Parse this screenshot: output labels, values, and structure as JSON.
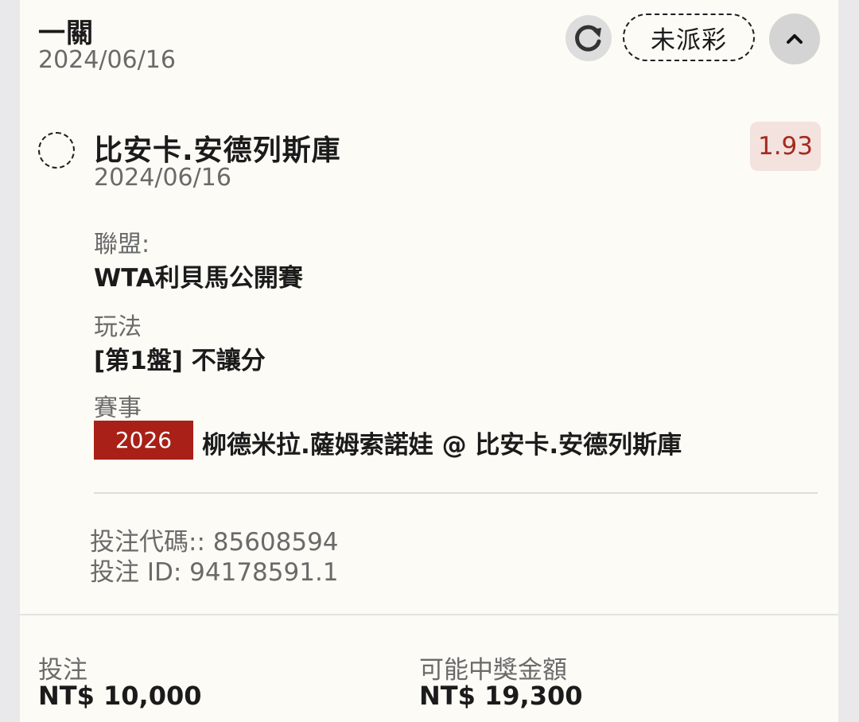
{
  "header": {
    "title": "一關",
    "date": "2024/06/16",
    "status": "未派彩"
  },
  "selection": {
    "name": "比安卡.安德列斯庫",
    "date": "2024/06/16",
    "odds": "1.93"
  },
  "details": {
    "league_label": "聯盟:",
    "league_value": "WTA利貝馬公開賽",
    "market_label": "玩法",
    "market_value": "[第1盤] 不讓分",
    "event_label": "賽事",
    "event_code": "2026",
    "event_name": "柳德米拉.薩姆索諾娃 @ 比安卡.安德列斯庫"
  },
  "ids": {
    "bet_code": "投注代碼:: 85608594",
    "bet_id": "投注 ID: 94178591.1"
  },
  "footer": {
    "stake_label": "投注",
    "stake_value": "NT$ 10,000",
    "payout_label": "可能中獎金額",
    "payout_value": "NT$ 19,300"
  },
  "colors": {
    "accent_red": "#a82017",
    "odds_bg": "#f3e2dd",
    "card_bg": "#fcfbf5"
  },
  "icons": {
    "refresh": "refresh-icon",
    "collapse": "chevron-up-icon"
  }
}
